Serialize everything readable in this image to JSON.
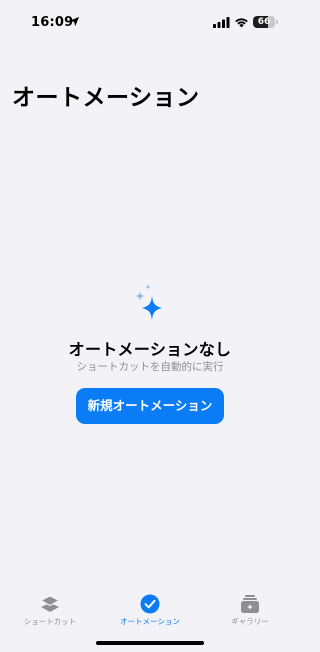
{
  "status_bar": {
    "time": "16:09",
    "battery_level": "66",
    "battery_fraction": 0.66
  },
  "page": {
    "title": "オートメーション"
  },
  "empty_state": {
    "icon": "sparkles-icon",
    "title": "オートメーションなし",
    "subtitle": "ショートカットを自動的に実行",
    "button_label": "新規オートメーション"
  },
  "tab_bar": {
    "tabs": [
      {
        "label": "ショートカット",
        "icon": "layers-icon",
        "active": false
      },
      {
        "label": "オートメーション",
        "icon": "checkmark-circle-icon",
        "active": true
      },
      {
        "label": "ギャラリー",
        "icon": "gallery-icon",
        "active": false
      }
    ]
  },
  "colors": {
    "accent": "#0a7cf5",
    "background": "#f2f2f7",
    "secondary_text": "#8e8e93",
    "inactive_icon": "#8e8e93"
  }
}
